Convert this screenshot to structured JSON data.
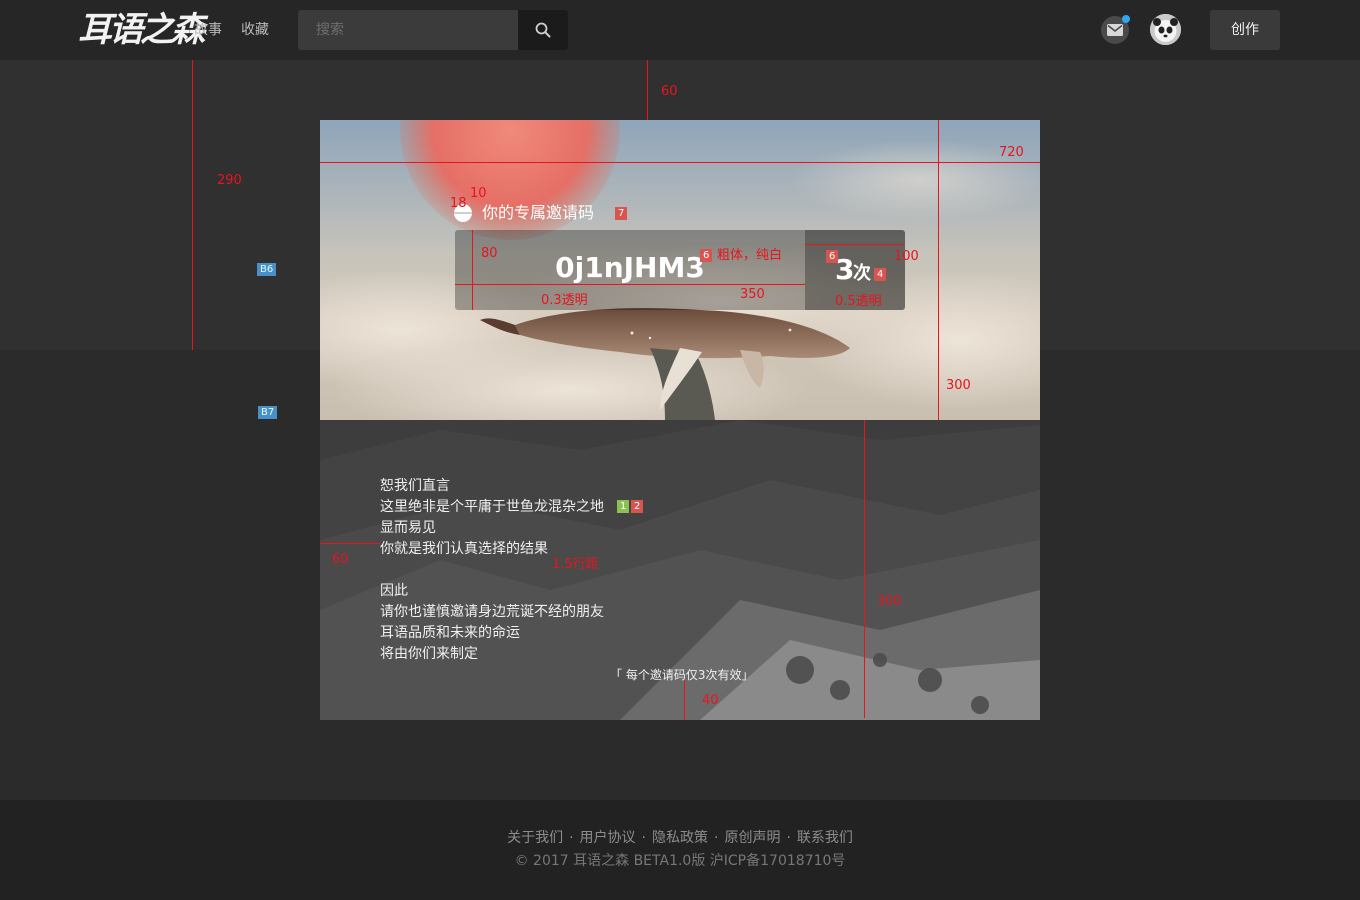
{
  "header": {
    "logo": "耳语之森",
    "nav": [
      "故事",
      "收藏"
    ],
    "search_placeholder": "搜索",
    "create_label": "创作"
  },
  "hero": {
    "invite_title": "你的专属邀请码",
    "code": "0j1nJHM3",
    "count_num": "3",
    "count_unit": "次"
  },
  "manifesto": {
    "lines_1": [
      "恕我们直言",
      "这里绝非是个平庸于世鱼龙混杂之地",
      "显而易见",
      "你就是我们认真选择的结果"
    ],
    "lines_2": [
      "因此",
      "请你也谨慎邀请身边荒诞不经的朋友",
      "耳语品质和未来的命运",
      "将由你们来制定"
    ],
    "footnote": "「 每个邀请码仅3次有效」"
  },
  "footer": {
    "links": [
      "关于我们",
      "用户协议",
      "隐私政策",
      "原创声明",
      "联系我们"
    ],
    "separator": "·",
    "copyright": "© 2017  耳语之森  BETA1.0版  沪ICP备17018710号"
  },
  "annotations": {
    "top_margin": "60",
    "left_offset": "290",
    "hero_width": "720",
    "hero_height": "300",
    "dot_gap": "10",
    "dot_size": "18",
    "box_height": "80",
    "bold_white": "粗体，纯白",
    "box_width": "350",
    "count_width": "100",
    "opacity_03": "0.3透明",
    "opacity_05": "0.5透明",
    "text_left": "60",
    "line_height": "1.5行距",
    "section_height": "300",
    "bottom_gap": "40",
    "tag_7": "7",
    "tag_6a": "6",
    "tag_6b": "6",
    "tag_4": "4",
    "tag_1": "1",
    "tag_2": "2",
    "band_b6": "B6",
    "band_b7": "B7"
  },
  "colors": {
    "header_bg": "#262626",
    "page_bg": "#303030",
    "lower_band_bg": "#2b2b2b",
    "footer_bg": "#222222",
    "annotation": "#e8141f",
    "notification_dot": "#2fa6f2"
  }
}
